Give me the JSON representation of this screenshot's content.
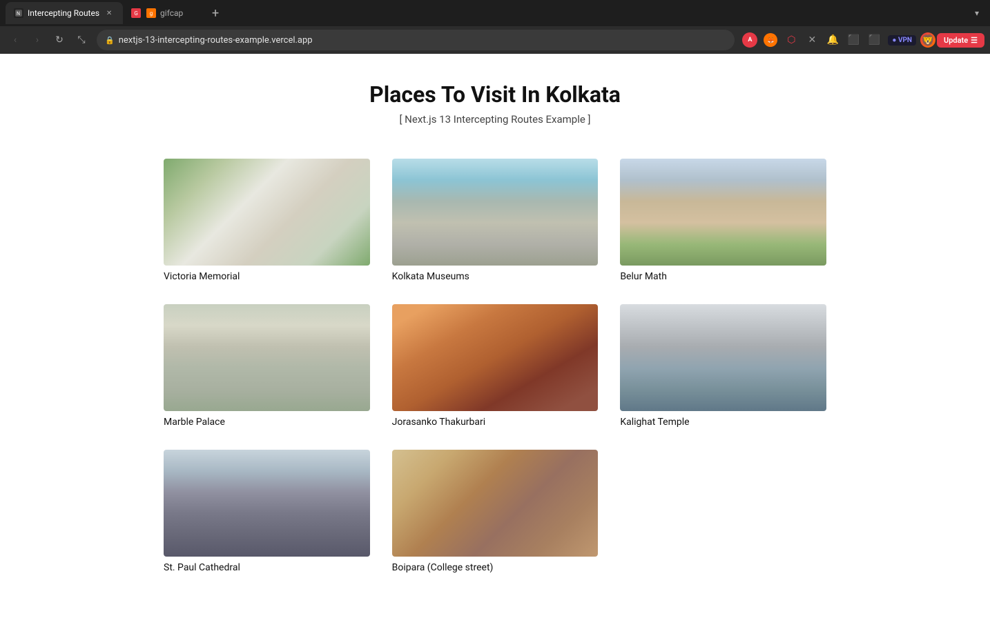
{
  "browser": {
    "tabs": [
      {
        "id": "tab-1",
        "label": "Intercepting Routes",
        "favicon": "🔒",
        "active": true
      },
      {
        "id": "tab-2",
        "label": "gifcap",
        "favicon": "🎬",
        "active": false
      }
    ],
    "add_tab_label": "+",
    "nav": {
      "back_disabled": true,
      "forward_disabled": true,
      "reload_label": "⟳"
    },
    "address_bar": {
      "url": "nextjs-13-intercepting-routes-example.vercel.app",
      "lock_icon": "🔒"
    },
    "update_button": "Update",
    "vpn_label": "● VPN"
  },
  "page": {
    "title": "Places To Visit In Kolkata",
    "subtitle": "[ Next.js 13 Intercepting Routes Example ]",
    "places": [
      {
        "id": "victoria-memorial",
        "name": "Victoria Memorial",
        "img_class": "img-victoria-memorial"
      },
      {
        "id": "kolkata-museums",
        "name": "Kolkata Museums",
        "img_class": "img-kolkata-museums"
      },
      {
        "id": "belur-math",
        "name": "Belur Math",
        "img_class": "img-belur-math"
      },
      {
        "id": "marble-palace",
        "name": "Marble Palace",
        "img_class": "img-marble-palace"
      },
      {
        "id": "jorasanko-thakurbari",
        "name": "Jorasanko Thakurbari",
        "img_class": "img-jorasanko"
      },
      {
        "id": "kalighat-temple",
        "name": "Kalighat Temple",
        "img_class": "img-kalighat"
      },
      {
        "id": "st-paul-cathedral",
        "name": "St. Paul Cathedral",
        "img_class": "img-st-paul"
      },
      {
        "id": "boipara",
        "name": "Boipara (College street)",
        "img_class": "img-boipara"
      }
    ]
  }
}
